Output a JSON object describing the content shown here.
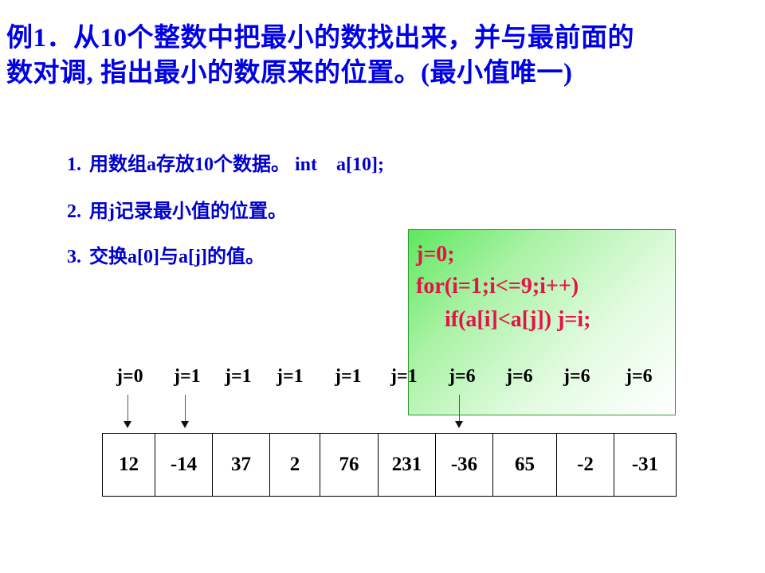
{
  "title": {
    "line1": "例1．从10个整数中把最小的数找出来，并与最前面的",
    "line2": "数对调, 指出最小的数原来的位置。(最小值唯一)"
  },
  "steps": [
    {
      "num": "1.",
      "text": "用数组a存放10个数据。 int    a[10];"
    },
    {
      "num": "2.",
      "text": "用j记录最小值的位置。"
    },
    {
      "num": "3.",
      "text": "交换a[0]与a[j]的值。"
    }
  ],
  "code": {
    "line1": "j=0;",
    "line2": "for(i=1;i<=9;i++)",
    "line3": "if(a[i]<a[j]) j=i;"
  },
  "j_labels": [
    "j=0",
    "j=1",
    "j=1",
    "j=1",
    "j=1",
    "j=1",
    "j=6",
    "j=6",
    "j=6",
    "j=6"
  ],
  "array_values": [
    "12",
    "-14",
    "37",
    "2",
    "76",
    "231",
    "-36",
    "65",
    "-2",
    "-31"
  ],
  "colors": {
    "title": "#0000e6",
    "steps": "#0000cc",
    "code": "#e8104a",
    "codebox_border": "#2e9a2e",
    "codebox_fill": "#5ee85e"
  }
}
